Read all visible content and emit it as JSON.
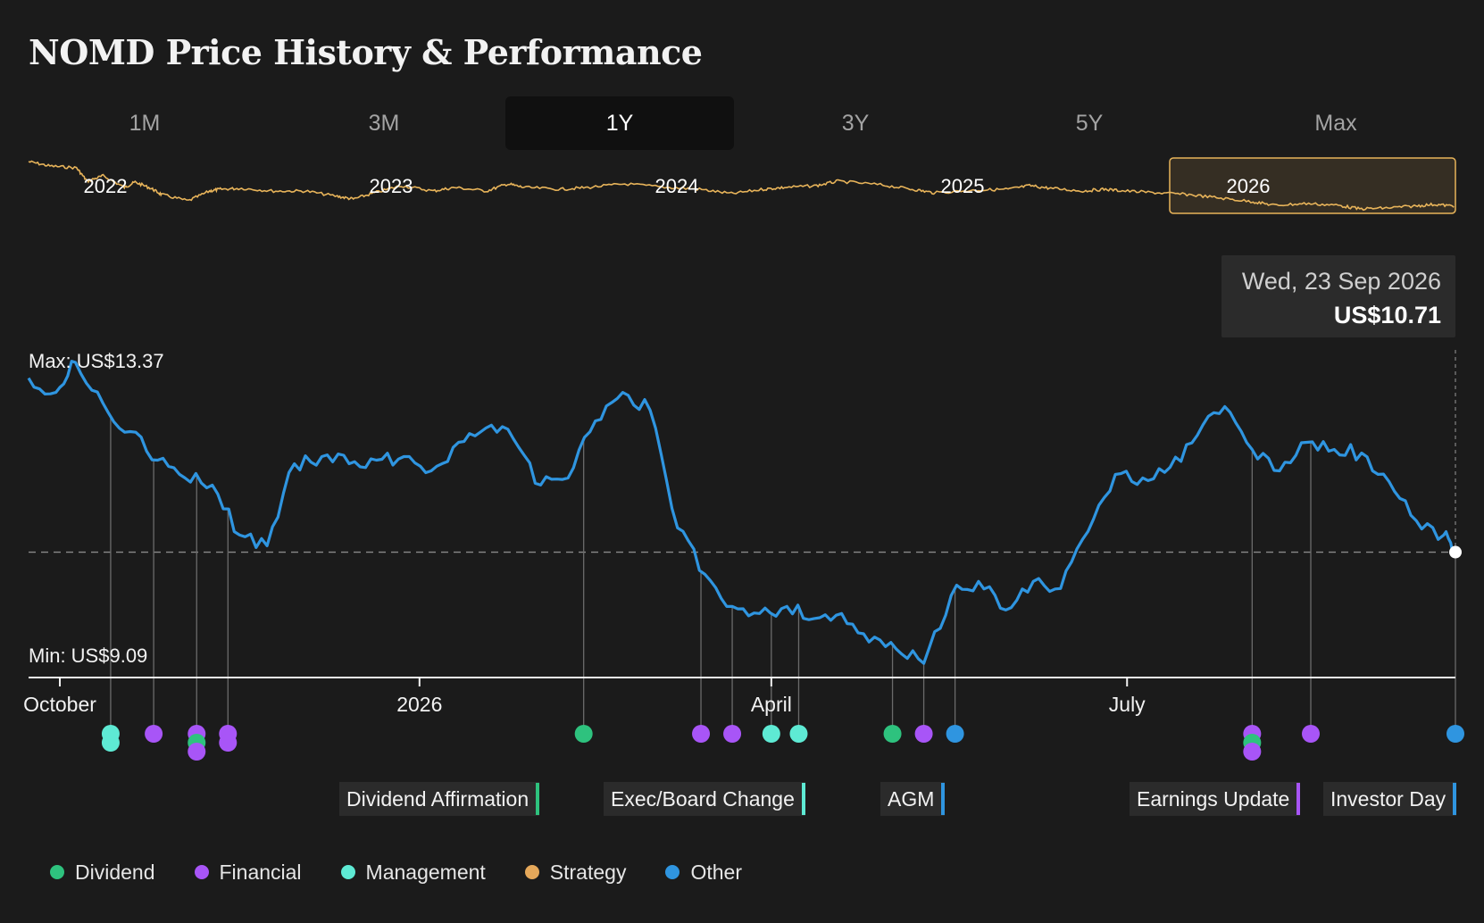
{
  "title": "NOMD Price History & Performance",
  "tabs": [
    {
      "label": "1M",
      "active": false
    },
    {
      "label": "3M",
      "active": false
    },
    {
      "label": "1Y",
      "active": true
    },
    {
      "label": "3Y",
      "active": false
    },
    {
      "label": "5Y",
      "active": false
    },
    {
      "label": "Max",
      "active": false
    }
  ],
  "navigator": {
    "year_labels": [
      "2022",
      "2023",
      "2024",
      "2025",
      "2026"
    ],
    "selected_year": "2026",
    "line_color": "#e8b45a"
  },
  "tooltip": {
    "date": "Wed, 23 Sep 2026",
    "price": "US$10.71"
  },
  "chart_labels": {
    "max": "Max: US$13.37",
    "min": "Min: US$9.09"
  },
  "event_labels": [
    {
      "text": "Dividend Affirmation",
      "category": "Dividend"
    },
    {
      "text": "Exec/Board Change",
      "category": "Management"
    },
    {
      "text": "AGM",
      "category": "Other"
    },
    {
      "text": "Earnings Update",
      "category": "Financial"
    },
    {
      "text": "Investor Day",
      "category": "Other"
    }
  ],
  "legend": [
    {
      "label": "Dividend",
      "color": "#2ec27e"
    },
    {
      "label": "Financial",
      "color": "#a855f7"
    },
    {
      "label": "Management",
      "color": "#5eead4"
    },
    {
      "label": "Strategy",
      "color": "#e5a85a"
    },
    {
      "label": "Other",
      "color": "#2f95e0"
    }
  ],
  "chart_data": {
    "type": "line",
    "title": "NOMD Price History & Performance",
    "x_tick_labels": [
      "October",
      "2026",
      "April",
      "July"
    ],
    "ylim": [
      9.09,
      13.37
    ],
    "series": [
      {
        "color": "#2f95e0",
        "points": [
          [
            "2025-09-23",
            13.15
          ],
          [
            "2025-09-30",
            12.95
          ],
          [
            "2025-10-05",
            13.37
          ],
          [
            "2025-10-12",
            12.8
          ],
          [
            "2025-10-19",
            12.4
          ],
          [
            "2025-10-26",
            12.0
          ],
          [
            "2025-11-02",
            11.75
          ],
          [
            "2025-11-09",
            11.65
          ],
          [
            "2025-11-16",
            10.95
          ],
          [
            "2025-11-23",
            10.8
          ],
          [
            "2025-11-30",
            11.95
          ],
          [
            "2025-12-07",
            12.05
          ],
          [
            "2025-12-14",
            11.95
          ],
          [
            "2025-12-21",
            12.0
          ],
          [
            "2025-12-28",
            12.05
          ],
          [
            "2026-01-04",
            11.85
          ],
          [
            "2026-01-11",
            12.25
          ],
          [
            "2026-01-18",
            12.45
          ],
          [
            "2026-01-25",
            12.3
          ],
          [
            "2026-02-01",
            11.65
          ],
          [
            "2026-02-08",
            11.75
          ],
          [
            "2026-02-15",
            12.55
          ],
          [
            "2026-02-22",
            12.95
          ],
          [
            "2026-03-01",
            12.7
          ],
          [
            "2026-03-08",
            11.05
          ],
          [
            "2026-03-15",
            10.4
          ],
          [
            "2026-03-22",
            9.95
          ],
          [
            "2026-03-29",
            9.85
          ],
          [
            "2026-04-05",
            9.95
          ],
          [
            "2026-04-12",
            9.78
          ],
          [
            "2026-04-19",
            9.85
          ],
          [
            "2026-04-26",
            9.45
          ],
          [
            "2026-05-03",
            9.35
          ],
          [
            "2026-05-10",
            9.15
          ],
          [
            "2026-05-17",
            10.1
          ],
          [
            "2026-05-24",
            10.3
          ],
          [
            "2026-05-31",
            9.9
          ],
          [
            "2026-06-07",
            10.3
          ],
          [
            "2026-06-14",
            10.2
          ],
          [
            "2026-06-21",
            11.0
          ],
          [
            "2026-06-28",
            11.8
          ],
          [
            "2026-07-05",
            11.75
          ],
          [
            "2026-07-12",
            11.9
          ],
          [
            "2026-07-19",
            12.35
          ],
          [
            "2026-07-26",
            12.75
          ],
          [
            "2026-08-02",
            12.15
          ],
          [
            "2026-08-09",
            11.85
          ],
          [
            "2026-08-16",
            12.25
          ],
          [
            "2026-08-23",
            12.15
          ],
          [
            "2026-08-30",
            12.1
          ],
          [
            "2026-09-06",
            11.7
          ],
          [
            "2026-09-13",
            11.15
          ],
          [
            "2026-09-20",
            10.95
          ],
          [
            "2026-09-23",
            10.71
          ]
        ]
      }
    ],
    "reference_line": {
      "value": 10.71,
      "style": "dashed"
    },
    "events": [
      {
        "date": "2025-10-14",
        "categories": [
          "Management",
          "Management"
        ]
      },
      {
        "date": "2025-10-25",
        "categories": [
          "Financial"
        ]
      },
      {
        "date": "2025-11-05",
        "categories": [
          "Financial",
          "Dividend",
          "Financial"
        ]
      },
      {
        "date": "2025-11-13",
        "categories": [
          "Financial",
          "Financial"
        ]
      },
      {
        "date": "2026-02-12",
        "categories": [
          "Dividend"
        ]
      },
      {
        "date": "2026-03-14",
        "categories": [
          "Financial"
        ]
      },
      {
        "date": "2026-03-22",
        "categories": [
          "Financial"
        ]
      },
      {
        "date": "2026-04-01",
        "categories": [
          "Management"
        ]
      },
      {
        "date": "2026-04-08",
        "categories": [
          "Management"
        ]
      },
      {
        "date": "2026-05-02",
        "categories": [
          "Dividend"
        ]
      },
      {
        "date": "2026-05-10",
        "categories": [
          "Financial"
        ]
      },
      {
        "date": "2026-05-18",
        "categories": [
          "Other"
        ]
      },
      {
        "date": "2026-08-02",
        "categories": [
          "Financial",
          "Dividend",
          "Financial"
        ]
      },
      {
        "date": "2026-08-17",
        "categories": [
          "Financial"
        ]
      },
      {
        "date": "2026-09-23",
        "categories": [
          "Other"
        ]
      }
    ]
  }
}
